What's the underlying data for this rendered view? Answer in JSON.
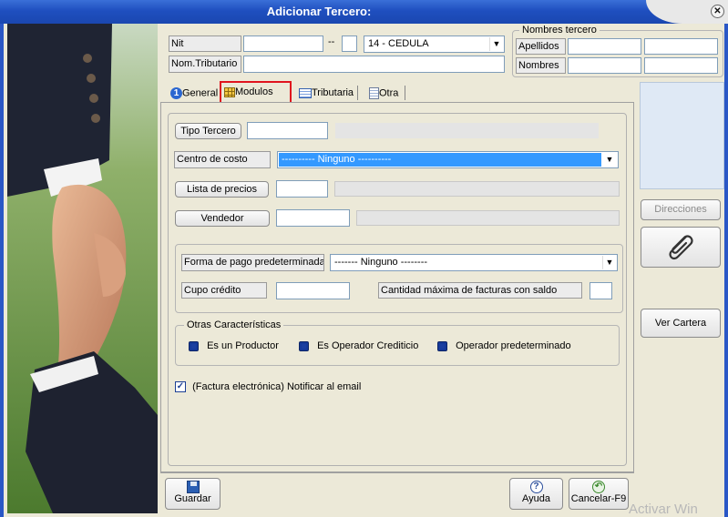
{
  "window": {
    "title": "Adicionar Tercero:",
    "close": "✕"
  },
  "header": {
    "nit_label": "Nit",
    "nit_value": "",
    "dv_sep": "--",
    "dv_value": "",
    "doc_type": "14 - CEDULA",
    "nom_tributario_label": "Nom.Tributario",
    "nom_tributario_value": ""
  },
  "nombres": {
    "legend": "Nombres tercero",
    "apellidos_label": "Apellidos",
    "nombres_label": "Nombres"
  },
  "tabs": [
    {
      "label": "General"
    },
    {
      "label": "Modulos"
    },
    {
      "label": "Tributaria"
    },
    {
      "label": "Otra"
    }
  ],
  "modulos": {
    "tipo_tercero_label": "Tipo Tercero",
    "centro_costo_label": "Centro de costo",
    "centro_costo_value": "---------- Ninguno ----------",
    "lista_precios_label": "Lista de precios",
    "vendedor_label": "Vendedor",
    "forma_pago_label": "Forma de pago predeterminada",
    "forma_pago_value": "------- Ninguno --------",
    "cupo_credito_label": "Cupo crédito",
    "cantidad_facturas_label": "Cantidad máxima de facturas con saldo",
    "otras_legend": "Otras Características",
    "options": [
      {
        "label": "Es un Productor"
      },
      {
        "label": "Es Operador Crediticio"
      },
      {
        "label": "Operador predeterminado"
      }
    ],
    "notificar_label": "(Factura electrónica) Notificar al email",
    "notificar_checked": true
  },
  "side": {
    "direcciones_label": "Direcciones",
    "ver_cartera_label": "Ver Cartera"
  },
  "footer": {
    "guardar_label": "Guardar",
    "ayuda_label": "Ayuda",
    "cancelar_label": "Cancelar-F9"
  },
  "watermark": "Activar Win"
}
